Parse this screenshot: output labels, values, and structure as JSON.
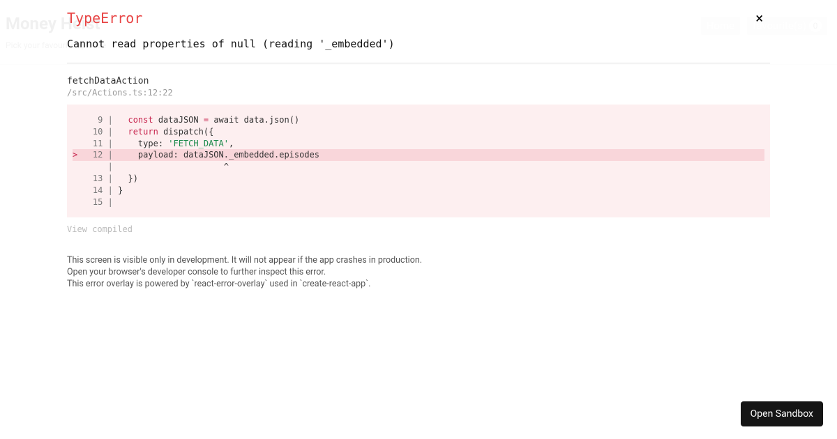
{
  "background": {
    "title": "Money Heist",
    "subtitle": "Pick your favourite episode",
    "nav": {
      "home": "Home",
      "favourite": "favourite(s)",
      "favourite_count": "0"
    }
  },
  "error": {
    "type": "TypeError",
    "message": "Cannot read properties of null (reading '_embedded')",
    "function_name": "fetchDataAction",
    "location": "/src/Actions.ts:12:22",
    "code": {
      "lines": [
        {
          "num": "9",
          "prefix": "  ",
          "gutter": "   9 | ",
          "text_a": "  ",
          "kw": "const",
          "text_b": " dataJSON ",
          "op": "=",
          "text_c": " await data.json()",
          "hl": false
        },
        {
          "num": "10",
          "prefix": "  ",
          "gutter": "  10 | ",
          "text_a": "  ",
          "kw": "return",
          "text_b": " dispatch({",
          "op": "",
          "text_c": "",
          "hl": false
        },
        {
          "num": "11",
          "prefix": "  ",
          "gutter": "  11 | ",
          "text_a": "    type: ",
          "kw": "",
          "text_b": "",
          "op": "",
          "str": "'FETCH_DATA'",
          "text_c": ",",
          "hl": false
        },
        {
          "num": "12",
          "prefix": "> ",
          "gutter": "  12 | ",
          "text_a": "    payload: dataJSON._embedded.episodes",
          "kw": "",
          "text_b": "",
          "op": "",
          "text_c": "",
          "hl": true
        },
        {
          "num": "",
          "prefix": "  ",
          "gutter": "     | ",
          "text_a": "                     ^",
          "kw": "",
          "text_b": "",
          "op": "",
          "text_c": "",
          "hl": false
        },
        {
          "num": "13",
          "prefix": "  ",
          "gutter": "  13 | ",
          "text_a": "  })",
          "kw": "",
          "text_b": "",
          "op": "",
          "text_c": "",
          "hl": false
        },
        {
          "num": "14",
          "prefix": "  ",
          "gutter": "  14 | ",
          "text_a": "}",
          "kw": "",
          "text_b": "",
          "op": "",
          "text_c": "",
          "hl": false
        },
        {
          "num": "15",
          "prefix": "  ",
          "gutter": "  15 | ",
          "text_a": "",
          "kw": "",
          "text_b": "",
          "op": "",
          "text_c": "",
          "hl": false
        }
      ]
    },
    "view_compiled": "View compiled",
    "dev_notes": [
      "This screen is visible only in development. It will not appear if the app crashes in production.",
      "Open your browser's developer console to further inspect this error.",
      "This error overlay is powered by `react-error-overlay` used in `create-react-app`."
    ]
  },
  "sandbox": {
    "open_label": "Open Sandbox"
  }
}
